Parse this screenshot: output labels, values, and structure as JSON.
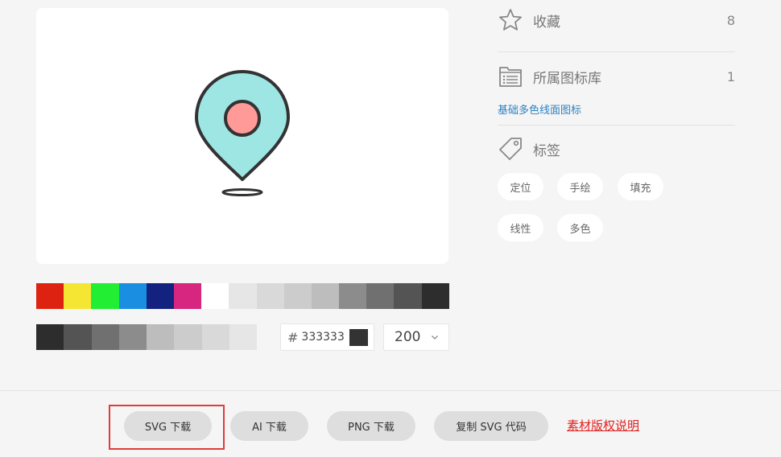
{
  "palette": {
    "row1": [
      "#dd2211",
      "#f5e633",
      "#22ee33",
      "#1a8ee0",
      "#13227f",
      "#d62680",
      "#ffffff",
      "#e6e6e6",
      "#d9d9d9",
      "#cccccc",
      "#bdbdbd",
      "#8c8c8c",
      "#707070",
      "#545454",
      "#2d2d2d"
    ],
    "row2": [
      "#2d2d2d",
      "#545454",
      "#707070",
      "#8c8c8c",
      "#bdbdbd",
      "#cccccc",
      "#d9d9d9",
      "#e6e6e6"
    ]
  },
  "color_input": {
    "hash": "#",
    "value": "333333",
    "swatch": "#333333"
  },
  "size_select": {
    "value": "200"
  },
  "sidebar": {
    "favorites": {
      "label": "收藏",
      "count": "8"
    },
    "library": {
      "label": "所属图标库",
      "count": "1",
      "link": "基础多色线面图标"
    },
    "tags_title": "标签",
    "tags": [
      "定位",
      "手绘",
      "填充",
      "线性",
      "多色"
    ]
  },
  "footer": {
    "buttons": [
      "SVG 下载",
      "AI 下载",
      "PNG 下载",
      "复制 SVG 代码"
    ],
    "copyright": "素材版权说明"
  },
  "icon_colors": {
    "fill": "#9de6e3",
    "dot": "#ff9a98",
    "stroke": "#333333"
  }
}
